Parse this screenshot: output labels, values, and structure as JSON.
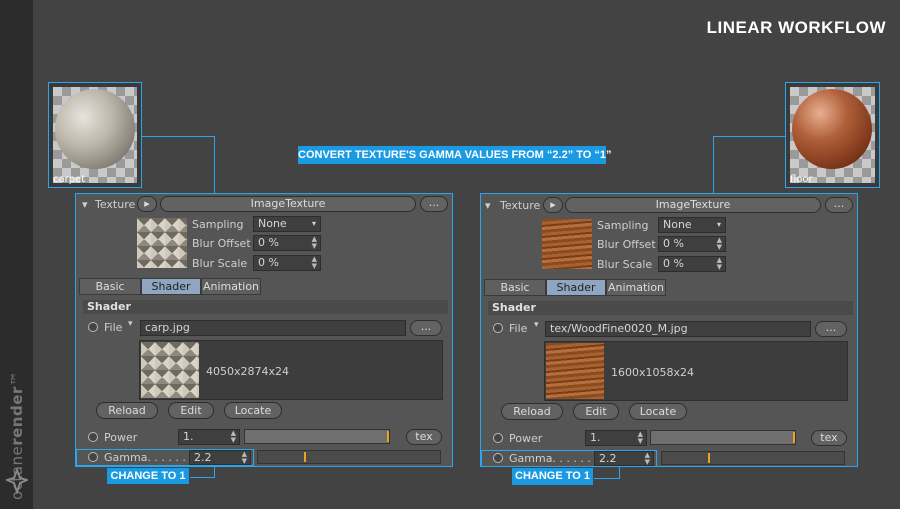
{
  "brand": {
    "prefix": "octane",
    "suffix": "render",
    "tm": "™"
  },
  "title": "LINEAR WORKFLOW",
  "callout_top": "CONVERT TEXTURE'S GAMMA VALUES FROM “2.2” TO “1”",
  "left": {
    "thumb_label": "carpet",
    "texture_label": "Texture",
    "texture_name": "ImageTexture",
    "dots": "...",
    "sampling_label": "Sampling",
    "sampling_value": "None",
    "blur_offset_label": "Blur Offset",
    "blur_offset_value": "0 %",
    "blur_scale_label": "Blur Scale",
    "blur_scale_value": "0 %",
    "tabs": [
      "Basic",
      "Shader",
      "Animation"
    ],
    "section": "Shader",
    "file_label": "File",
    "file_value": "carp.jpg",
    "resolution": "4050x2874x24",
    "reload": "Reload",
    "edit": "Edit",
    "locate": "Locate",
    "power_label": "Power",
    "power_value": "1.",
    "tex_button": "tex",
    "gamma_label": "Gamma. . . . . . .",
    "gamma_value": "2.2",
    "callout": "CHANGE TO 1"
  },
  "right": {
    "thumb_label": "floor",
    "texture_label": "Texture",
    "texture_name": "ImageTexture",
    "dots": "...",
    "sampling_label": "Sampling",
    "sampling_value": "None",
    "blur_offset_label": "Blur Offset",
    "blur_offset_value": "0 %",
    "blur_scale_label": "Blur Scale",
    "blur_scale_value": "0 %",
    "tabs": [
      "Basic",
      "Shader",
      "Animation"
    ],
    "section": "Shader",
    "file_label": "File",
    "file_value": "tex/WoodFine0020_M.jpg",
    "resolution": "1600x1058x24",
    "reload": "Reload",
    "edit": "Edit",
    "locate": "Locate",
    "power_label": "Power",
    "power_value": "1.",
    "tex_button": "tex",
    "gamma_label": "Gamma. . . . . . .",
    "gamma_value": "2.2",
    "callout": "CHANGE TO 1"
  },
  "colors": {
    "accent": "#2aa6ee",
    "callout_bg": "#1a9ae3",
    "slider_tick": "#f0a020"
  }
}
